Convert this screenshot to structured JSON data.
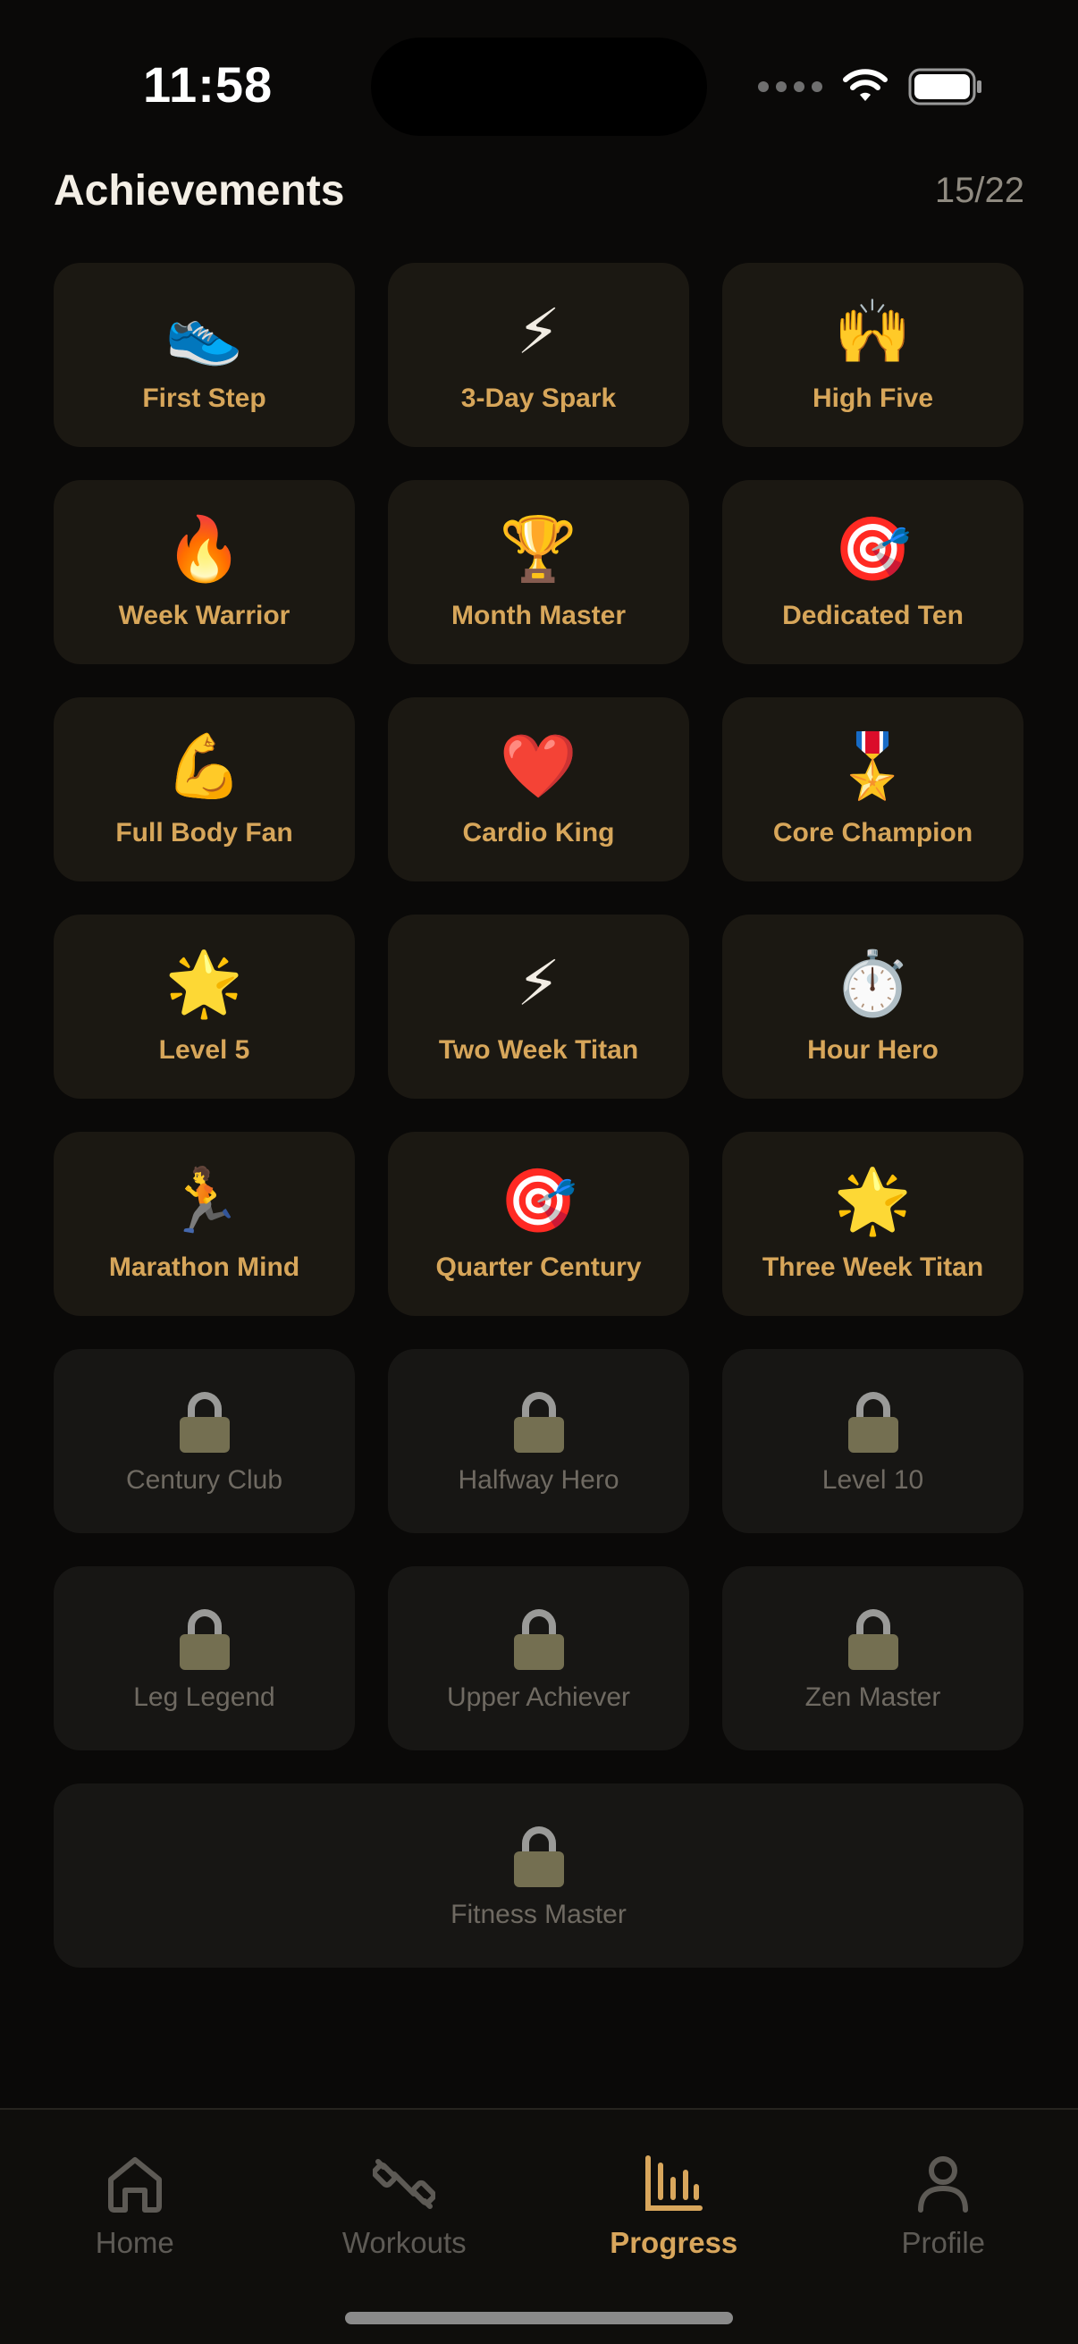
{
  "status": {
    "time": "11:58"
  },
  "header": {
    "title": "Achievements",
    "count": "15/22"
  },
  "achievements": [
    {
      "label": "First Step",
      "icon": "👟",
      "icon_name": "sneaker-icon",
      "unlocked": true
    },
    {
      "label": "3-Day Spark",
      "icon": "⚡",
      "icon_name": "lightning-icon",
      "unlocked": true
    },
    {
      "label": "High Five",
      "icon": "🙌",
      "icon_name": "raised-hands-icon",
      "unlocked": true
    },
    {
      "label": "Week Warrior",
      "icon": "🔥",
      "icon_name": "fire-icon",
      "unlocked": true
    },
    {
      "label": "Month Master",
      "icon": "🏆",
      "icon_name": "trophy-icon",
      "unlocked": true
    },
    {
      "label": "Dedicated Ten",
      "icon": "🎯",
      "icon_name": "target-icon",
      "unlocked": true
    },
    {
      "label": "Full Body Fan",
      "icon": "💪",
      "icon_name": "flexed-biceps-icon",
      "unlocked": true
    },
    {
      "label": "Cardio King",
      "icon": "❤️",
      "icon_name": "heart-icon",
      "unlocked": true
    },
    {
      "label": "Core Champion",
      "icon": "🎖️",
      "icon_name": "medal-icon",
      "unlocked": true
    },
    {
      "label": "Level 5",
      "icon": "🌟",
      "icon_name": "glowing-star-icon",
      "unlocked": true
    },
    {
      "label": "Two Week Titan",
      "icon": "⚡",
      "icon_name": "lightning-icon",
      "unlocked": true
    },
    {
      "label": "Hour Hero",
      "icon": "⏱️",
      "icon_name": "stopwatch-icon",
      "unlocked": true
    },
    {
      "label": "Marathon Mind",
      "icon": "🏃",
      "icon_name": "runner-icon",
      "unlocked": true
    },
    {
      "label": "Quarter Century",
      "icon": "🎯",
      "icon_name": "target-icon",
      "unlocked": true
    },
    {
      "label": "Three Week Titan",
      "icon": "🌟",
      "icon_name": "glowing-star-icon",
      "unlocked": true
    },
    {
      "label": "Century Club",
      "icon": "",
      "icon_name": "lock-icon",
      "unlocked": false
    },
    {
      "label": "Halfway Hero",
      "icon": "",
      "icon_name": "lock-icon",
      "unlocked": false
    },
    {
      "label": "Level 10",
      "icon": "",
      "icon_name": "lock-icon",
      "unlocked": false
    },
    {
      "label": "Leg Legend",
      "icon": "",
      "icon_name": "lock-icon",
      "unlocked": false
    },
    {
      "label": "Upper Achiever",
      "icon": "",
      "icon_name": "lock-icon",
      "unlocked": false
    },
    {
      "label": "Zen Master",
      "icon": "",
      "icon_name": "lock-icon",
      "unlocked": false
    },
    {
      "label": "Fitness Master",
      "icon": "",
      "icon_name": "lock-icon",
      "unlocked": false
    }
  ],
  "tabs": [
    {
      "label": "Home",
      "icon_name": "home-icon",
      "active": false
    },
    {
      "label": "Workouts",
      "icon_name": "dumbbell-icon",
      "active": false
    },
    {
      "label": "Progress",
      "icon_name": "bar-chart-icon",
      "active": true
    },
    {
      "label": "Profile",
      "icon_name": "person-icon",
      "active": false
    }
  ],
  "colors": {
    "accent": "#d8a65c",
    "card": "#1b1812",
    "locked_card": "#171614",
    "background": "#0a0908"
  }
}
